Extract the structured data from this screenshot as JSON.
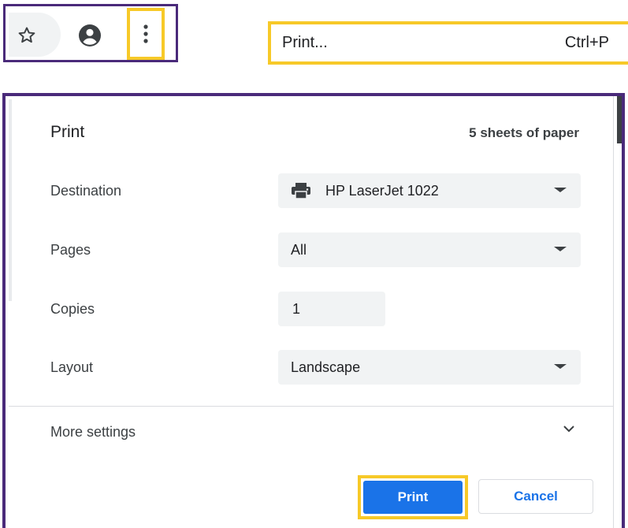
{
  "toolbar": {
    "icons": {
      "bookmark": "star-icon",
      "account": "account-icon",
      "menu": "three-dots-vertical-icon"
    }
  },
  "menu_item": {
    "label": "Print...",
    "shortcut": "Ctrl+P"
  },
  "print_dialog": {
    "title": "Print",
    "sheets": "5 sheets of paper",
    "destination": {
      "label": "Destination",
      "value": "HP LaserJet 1022",
      "icon": "printer-icon"
    },
    "pages": {
      "label": "Pages",
      "value": "All"
    },
    "copies": {
      "label": "Copies",
      "value": "1"
    },
    "layout": {
      "label": "Layout",
      "value": "Landscape"
    },
    "more_settings": {
      "label": "More settings"
    },
    "buttons": {
      "print": "Print",
      "cancel": "Cancel"
    }
  },
  "colors": {
    "frame": "#4a2a7a",
    "highlight": "#f7c928",
    "primary": "#1a73e8",
    "field_bg": "#f1f3f4"
  }
}
